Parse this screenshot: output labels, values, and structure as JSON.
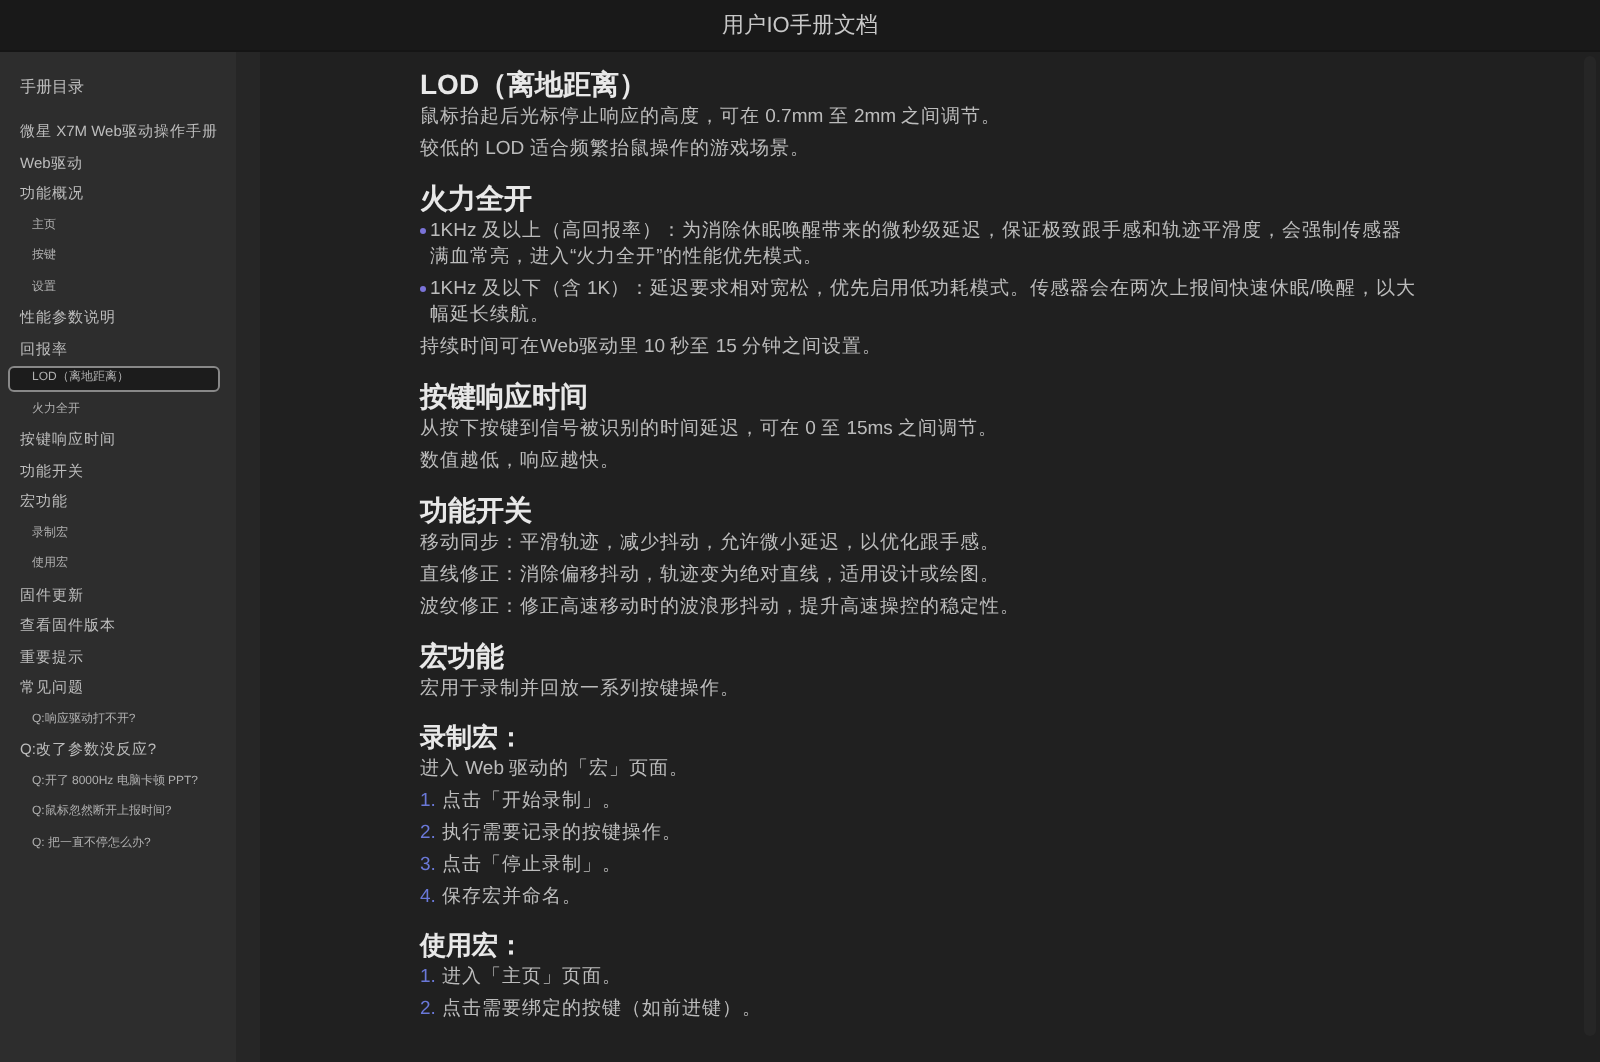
{
  "window": {
    "title": "用户IO手册文档"
  },
  "sidebar": {
    "title": "手册目录",
    "items": [
      {
        "label": "微星 X7M Web驱动操作手册",
        "selected": false
      },
      {
        "label": "Web驱动",
        "selected": false
      },
      {
        "label": "功能概况",
        "selected": false,
        "children": [
          {
            "label": "主页",
            "selected": false
          },
          {
            "label": "按键",
            "selected": false
          },
          {
            "label": "设置",
            "selected": false
          }
        ]
      },
      {
        "label": "性能参数说明",
        "selected": false
      },
      {
        "label": "回报率",
        "selected": false,
        "children": [
          {
            "label": "LOD（离地距离）",
            "selected": true
          },
          {
            "label": "火力全开",
            "selected": false
          }
        ]
      },
      {
        "label": "按键响应时间",
        "selected": false
      },
      {
        "label": "功能开关",
        "selected": false
      },
      {
        "label": "宏功能",
        "selected": false,
        "children": [
          {
            "label": "录制宏",
            "selected": false
          },
          {
            "label": "使用宏",
            "selected": false
          }
        ]
      },
      {
        "label": "固件更新",
        "selected": false
      },
      {
        "label": "查看固件版本",
        "selected": false
      },
      {
        "label": "重要提示",
        "selected": false
      },
      {
        "label": "常见问题",
        "selected": false,
        "children": [
          {
            "label": "Q:响应驱动打不开?",
            "selected": false
          }
        ]
      },
      {
        "label": "Q:改了参数没反应?",
        "selected": false,
        "children": [
          {
            "label": "Q:开了 8000Hz 电脑卡顿 PPT?",
            "selected": false
          },
          {
            "label": "Q:鼠标忽然断开上报时间?",
            "selected": false
          },
          {
            "label": "Q: 把一直不停怎么办?",
            "selected": false
          }
        ]
      }
    ]
  },
  "content": [
    {
      "heading": "LOD（离地距离）",
      "kind": "major",
      "blocks": [
        {
          "kind": "paragraph",
          "text": "鼠标抬起后光标停止响应的高度，可在 0.7mm 至 2mm 之间调节。"
        },
        {
          "kind": "paragraph",
          "text": "较低的 LOD 适合频繁抬鼠操作的游戏场景。"
        }
      ]
    },
    {
      "heading": "火力全开",
      "kind": "major",
      "blocks": [
        {
          "kind": "bullet",
          "text": "1KHz 及以上（高回报率）：为消除休眠唤醒带来的微秒级延迟，保证极致跟手感和轨迹平滑度，会强制传感器满血常亮，进入“火力全开”的性能优先模式。"
        },
        {
          "kind": "bullet",
          "text": "1KHz 及以下（含 1K）：延迟要求相对宽松，优先启用低功耗模式。传感器会在两次上报间快速休眠/唤醒，以大幅延长续航。"
        },
        {
          "kind": "paragraph",
          "text": "持续时间可在Web驱动里 10 秒至 15 分钟之间设置。"
        }
      ]
    },
    {
      "heading": "按键响应时间",
      "kind": "major",
      "blocks": [
        {
          "kind": "paragraph",
          "text": "从按下按键到信号被识别的时间延迟，可在 0 至 15ms 之间调节。"
        },
        {
          "kind": "paragraph",
          "text": "数值越低，响应越快。"
        }
      ]
    },
    {
      "heading": "功能开关",
      "kind": "major",
      "blocks": [
        {
          "kind": "paragraph",
          "text": "移动同步：平滑轨迹，减少抖动，允许微小延迟，以优化跟手感。"
        },
        {
          "kind": "paragraph",
          "text": "直线修正：消除偏移抖动，轨迹变为绝对直线，适用设计或绘图。"
        },
        {
          "kind": "paragraph",
          "text": "波纹修正：修正高速移动时的波浪形抖动，提升高速操控的稳定性。"
        }
      ]
    },
    {
      "heading": "宏功能",
      "kind": "major",
      "blocks": [
        {
          "kind": "paragraph",
          "text": "宏用于录制并回放一系列按键操作。"
        }
      ]
    },
    {
      "heading": "录制宏：",
      "kind": "minor",
      "blocks": [
        {
          "kind": "paragraph",
          "text": "进入 Web 驱动的「宏」页面。"
        },
        {
          "kind": "numbered",
          "marker": "1.",
          "text": "点击「开始录制」。"
        },
        {
          "kind": "numbered",
          "marker": "2.",
          "text": "执行需要记录的按键操作。"
        },
        {
          "kind": "numbered",
          "marker": "3.",
          "text": "点击「停止录制」。"
        },
        {
          "kind": "numbered",
          "marker": "4.",
          "text": "保存宏并命名。"
        }
      ]
    },
    {
      "heading": "使用宏：",
      "kind": "minor",
      "blocks": [
        {
          "kind": "numbered",
          "marker": "1.",
          "text": "进入「主页」页面。"
        },
        {
          "kind": "numbered",
          "marker": "2.",
          "text": "点击需要绑定的按键（如前进键）。"
        }
      ]
    }
  ]
}
